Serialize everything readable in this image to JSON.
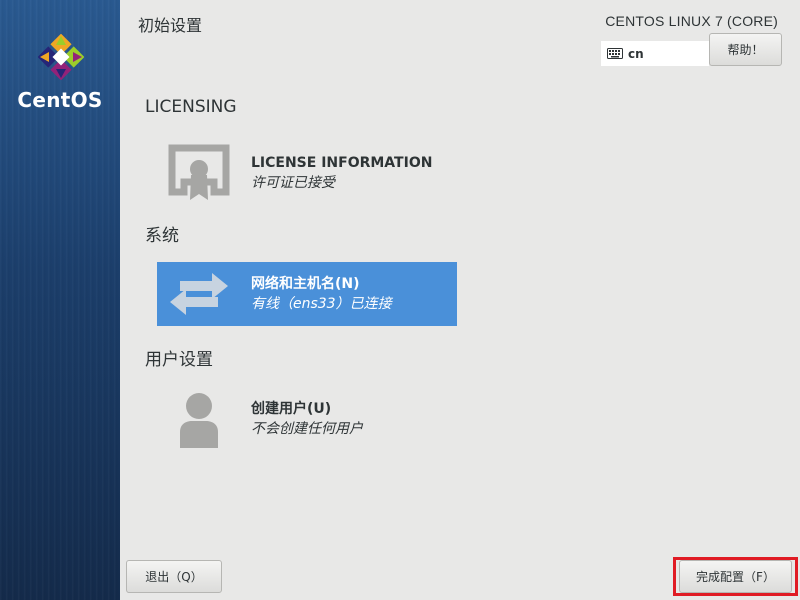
{
  "sidebar": {
    "brand": "CentOS",
    "logo_icon": "centos-logo-icon"
  },
  "header": {
    "title": "初始设置",
    "product": "CENTOS LINUX 7 (CORE)",
    "keyboard_layout": "cn",
    "help_label": "帮助！"
  },
  "sections": {
    "licensing": {
      "heading": "LICENSING",
      "license": {
        "title": "LICENSE INFORMATION",
        "status": "许可证已接受",
        "icon": "license-certificate-icon"
      }
    },
    "system": {
      "heading": "系统",
      "network": {
        "title": "网络和主机名(N)",
        "status": "有线（ens33）已连接",
        "icon": "network-arrows-icon"
      }
    },
    "user_settings": {
      "heading": "用户设置",
      "user": {
        "title": "创建用户(U)",
        "status": "不会创建任何用户",
        "icon": "user-silhouette-icon"
      }
    }
  },
  "footer": {
    "quit_label": "退出（Q）",
    "finish_label": "完成配置（F）"
  },
  "colors": {
    "sidebar": "#1c3f6c",
    "selected": "#4a90d9",
    "background": "#e8e8e7",
    "highlight": "#e01b24"
  }
}
